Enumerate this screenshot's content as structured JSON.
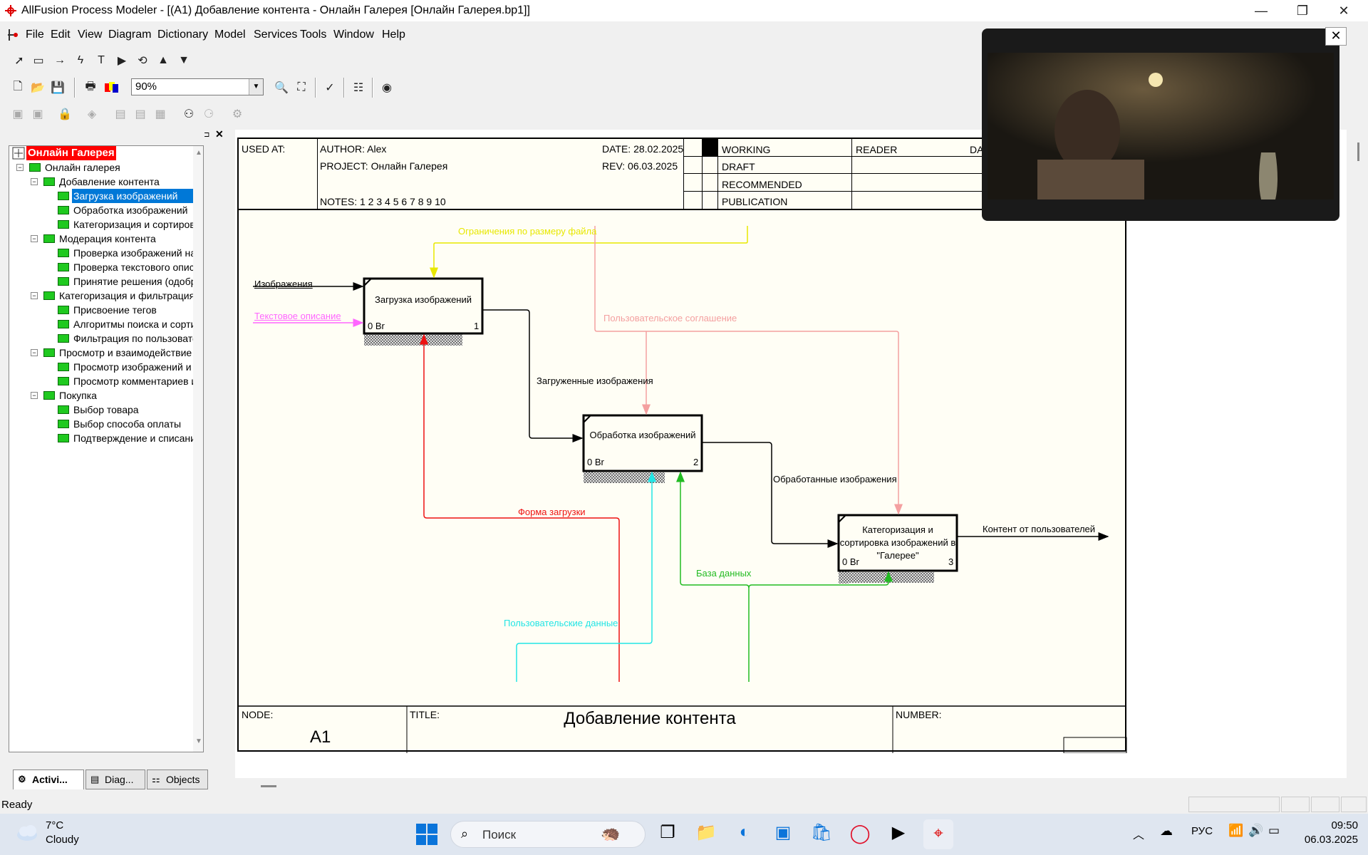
{
  "window": {
    "title": "AllFusion Process Modeler - [(A1) Добавление контента - Онлайн Галерея  [Онлайн Галерея.bp1]]",
    "minimize": "—",
    "restore": "❐",
    "close": "✕"
  },
  "menu": {
    "items": [
      {
        "label": "File",
        "key": "F"
      },
      {
        "label": "Edit",
        "key": "E"
      },
      {
        "label": "View",
        "key": "V"
      },
      {
        "label": "Diagram",
        "key": "D"
      },
      {
        "label": "Dictionary",
        "key": "c"
      },
      {
        "label": "Model",
        "key": "M"
      },
      {
        "label": "Services",
        "key": "S"
      },
      {
        "label": "Tools",
        "key": "T"
      },
      {
        "label": "Window",
        "key": "W"
      },
      {
        "label": "Help",
        "key": "H"
      }
    ]
  },
  "toolbar": {
    "zoom_value": "90%"
  },
  "tree": {
    "root": "Онлайн Галерея",
    "items": [
      {
        "label": "Онлайн галерея",
        "level": 0
      },
      {
        "label": "Добавление контента",
        "level": 1
      },
      {
        "label": "Загрузка изображений",
        "level": 2,
        "selected": true
      },
      {
        "label": "Обработка изображений",
        "level": 2
      },
      {
        "label": "Категоризация и сортировк",
        "level": 2
      },
      {
        "label": "Модерация контента",
        "level": 1
      },
      {
        "label": "Проверка изображений на с",
        "level": 2
      },
      {
        "label": "Проверка текстового описа",
        "level": 2
      },
      {
        "label": "Принятие решения (одобрен",
        "level": 2
      },
      {
        "label": "Категоризация  и фильтрация",
        "level": 1
      },
      {
        "label": "Присвоение тегов",
        "level": 2
      },
      {
        "label": "Алгоритмы поиска и сортир",
        "level": 2
      },
      {
        "label": "Фильтрация по пользовате",
        "level": 2
      },
      {
        "label": "Просмотр и взаимодействие",
        "level": 1
      },
      {
        "label": "Просмотр изображений и о",
        "level": 2
      },
      {
        "label": "Просмотр комментариев и",
        "level": 2
      },
      {
        "label": "Покупка",
        "level": 1
      },
      {
        "label": "Выбор товара",
        "level": 2
      },
      {
        "label": "Выбор способа оплаты",
        "level": 2
      },
      {
        "label": "Подтверждение и списание",
        "level": 2
      }
    ]
  },
  "tabs": [
    {
      "label": "Activi..."
    },
    {
      "label": "Diag..."
    },
    {
      "label": "Objects"
    }
  ],
  "header": {
    "used_at": "USED AT:",
    "author_label": "AUTHOR:",
    "author": "Alex",
    "project_label": "PROJECT:",
    "project": "Онлайн Галерея",
    "date_label": "DATE:",
    "date": "28.02.2025",
    "rev_label": "REV:",
    "rev": "06.03.2025",
    "notes": "NOTES:  1  2  3  4  5  6  7  8  9  10",
    "status": [
      "WORKING",
      "DRAFT",
      "RECOMMENDED",
      "PUBLICATION"
    ],
    "reader": "READER",
    "da": "DA"
  },
  "diagram": {
    "boxes": [
      {
        "title": "Загрузка изображений",
        "cost": "0 Br",
        "num": "1"
      },
      {
        "title": "Обработка изображений",
        "cost": "0 Br",
        "num": "2"
      },
      {
        "title": "Категоризация и сортировка изображений в \"Галерее\"",
        "cost": "0 Br",
        "num": "3"
      }
    ],
    "arrows": {
      "a1": "Ограничения по размеру файла",
      "a2": "Изображения",
      "a3": "Текстовое описание",
      "a4": "Пользовательское соглашение",
      "a5": "Загруженные изображения",
      "a6": "Обработанные изображения",
      "a7": "Контент от пользователей",
      "a8": "Форма загрузки",
      "a9": "База данных",
      "a10": "Пользовательские данные"
    },
    "colors": {
      "yellow": "#e8e800",
      "pink": "#f4a0a0",
      "magenta": "#ff66ff",
      "red": "#ee1111",
      "green": "#22bb22",
      "cyan": "#22e5e5"
    }
  },
  "footer": {
    "node_label": "NODE:",
    "node": "A1",
    "title_label": "TITLE:",
    "title": "Добавление контента",
    "number_label": "NUMBER:"
  },
  "status": {
    "text": "Ready"
  },
  "taskbar": {
    "weather_temp": "7°C",
    "weather_desc": "Cloudy",
    "search": "Поиск",
    "lang": "РУС",
    "time": "09:50",
    "date": "06.03.2025"
  }
}
